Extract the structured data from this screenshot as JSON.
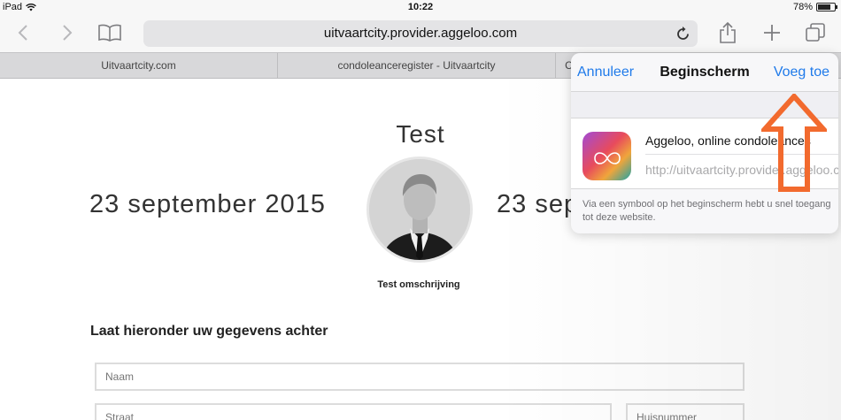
{
  "status_bar": {
    "device": "iPad",
    "time": "10:22",
    "battery": "78%",
    "battery_level": 0.78
  },
  "toolbar": {
    "url": "uitvaartcity.provider.aggeloo.com"
  },
  "tabs": [
    "Uitvaartcity.com",
    "condoleanceregister - Uitvaartcity",
    "C"
  ],
  "page": {
    "title": "Test",
    "date_left": "23 september 2015",
    "date_right": "23 sep",
    "portrait_caption": "Test omschrijving",
    "form_heading": "Laat hieronder uw gegevens achter",
    "fields": {
      "name_placeholder": "Naam",
      "street_placeholder": "Straat",
      "house_placeholder": "Huisnummer"
    }
  },
  "popover": {
    "cancel": "Annuleer",
    "title": "Beginscherm",
    "add": "Voeg toe",
    "app_name": "Aggeloo, online condoleances",
    "url": "http://uitvaartcity.provider.aggeloo.com",
    "note": "Via een symbool op het beginscherm hebt u snel toegang tot deze website."
  },
  "colors": {
    "accent": "#1f7aea",
    "arrow": "#f26a2e"
  }
}
